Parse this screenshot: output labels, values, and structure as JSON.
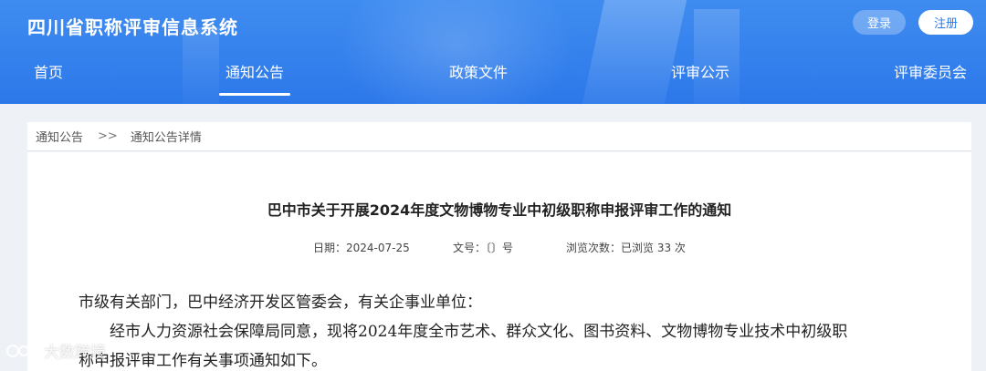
{
  "header": {
    "site_title": "四川省职称评审信息系统",
    "login_label": "登录",
    "register_label": "注册"
  },
  "nav": {
    "items": [
      {
        "label": "首页"
      },
      {
        "label": "通知公告"
      },
      {
        "label": "政策文件"
      },
      {
        "label": "评审公示"
      },
      {
        "label": "评审委员会"
      }
    ],
    "active": "通知公告"
  },
  "breadcrumb": {
    "items": [
      "通知公告",
      "通知公告详情"
    ],
    "separator": ">>"
  },
  "article": {
    "title": "巴中市关于开展2024年度文物博物专业中初级职称申报评审工作的通知",
    "date_label": "日期：",
    "date": "2024-07-25",
    "doc_no_label": "文号：",
    "doc_no": "〔〕号",
    "views_label": "浏览次数：",
    "views": "已浏览 33 次",
    "salutation": "市级有关部门，巴中经济开发区管委会，有关企事业单位：",
    "para1_line1": "经市人力资源社会保障局同意，现将2024年度全市艺术、群众文化、图书资料、文物博物专业技术中初级职",
    "para1_line2": "称申报评审工作有关事项通知如下。"
  },
  "watermark": {
    "text": "大数跨境"
  },
  "colors": {
    "header_blue": "#2c78ea",
    "page_bg": "#eef1f6"
  }
}
